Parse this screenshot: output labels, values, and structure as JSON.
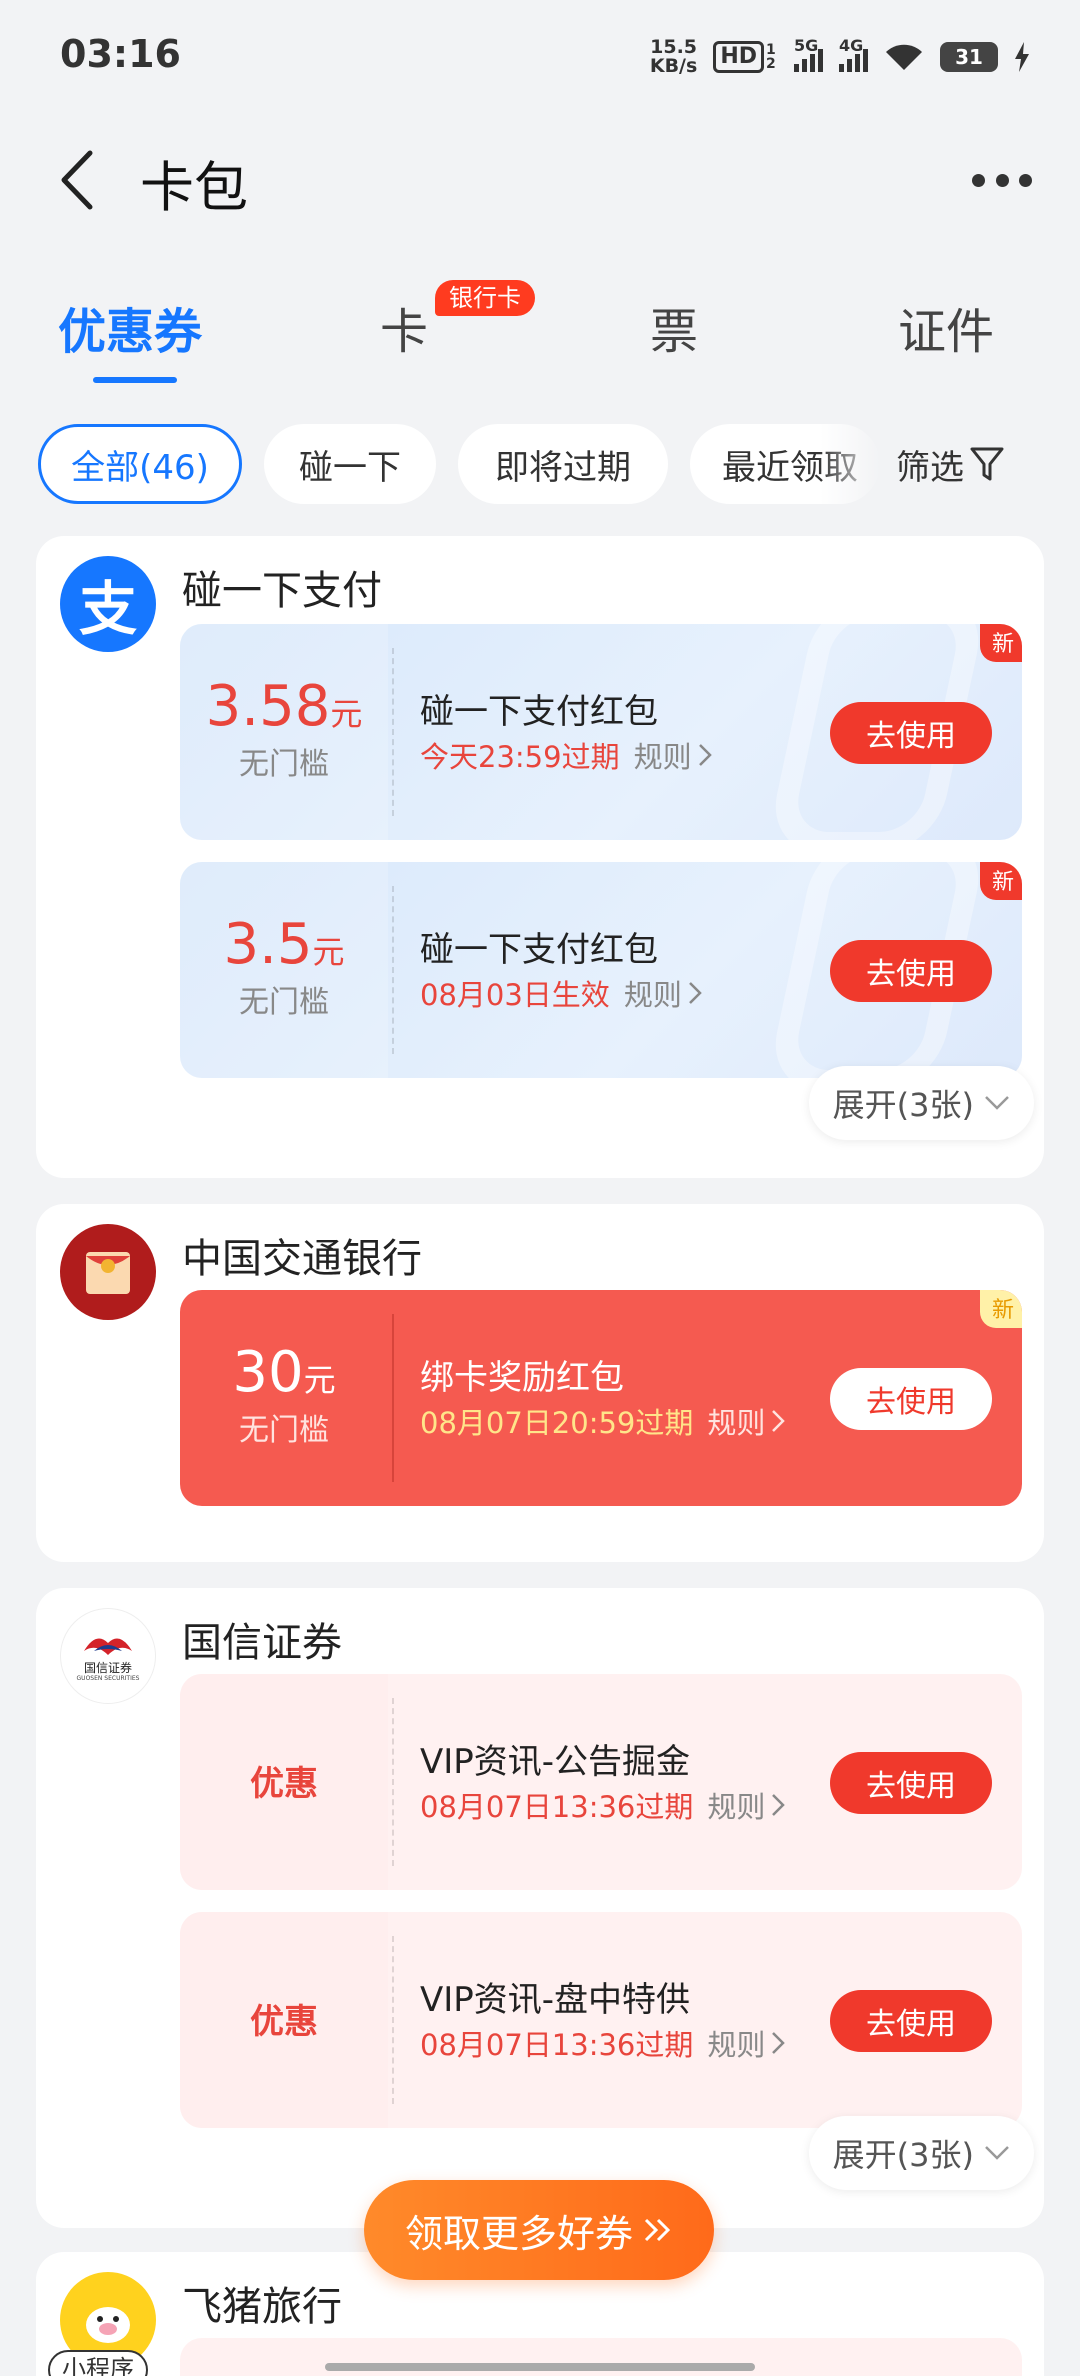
{
  "status": {
    "time": "03:16",
    "net_speed_value": "15.5",
    "net_speed_unit": "KB/s",
    "hd": "HD",
    "hd_sub": "1 2",
    "sig1_label": "5G",
    "sig2_label": "4G",
    "battery": "31"
  },
  "header": {
    "title": "卡包"
  },
  "tabs": {
    "items": [
      "优惠券",
      "卡",
      "票",
      "证件"
    ],
    "badge": "银行卡"
  },
  "chips": {
    "items": [
      "全部(46)",
      "碰一下",
      "即将过期",
      "最近领取"
    ],
    "filter": "筛选"
  },
  "sections": [
    {
      "name": "碰一下支付",
      "coupons": [
        {
          "amount": "3.58",
          "unit": "元",
          "cond": "无门槛",
          "title": "碰一下支付红包",
          "exp": "今天23:59过期",
          "rule": "规则",
          "btn": "去使用",
          "badge": "新"
        },
        {
          "amount": "3.5",
          "unit": "元",
          "cond": "无门槛",
          "title": "碰一下支付红包",
          "exp": "08月03日生效",
          "rule": "规则",
          "btn": "去使用",
          "badge": "新"
        }
      ],
      "expand": "展开(3张)"
    },
    {
      "name": "中国交通银行",
      "coupons": [
        {
          "amount": "30",
          "unit": "元",
          "cond": "无门槛",
          "title": "绑卡奖励红包",
          "exp": "08月07日20:59过期",
          "rule": "规则",
          "btn": "去使用",
          "badge": "新"
        }
      ]
    },
    {
      "name": "国信证券",
      "logo_text": "国信证券",
      "logo_sub": "GUOSEN SECURITIES",
      "coupons": [
        {
          "label": "优惠",
          "title": "VIP资讯-公告掘金",
          "exp": "08月07日13:36过期",
          "rule": "规则",
          "btn": "去使用"
        },
        {
          "label": "优惠",
          "title": "VIP资讯-盘中特供",
          "exp": "08月07日13:36过期",
          "rule": "规则",
          "btn": "去使用"
        }
      ],
      "expand": "展开(3张)"
    },
    {
      "name": "飞猪旅行",
      "mini_tag": "小程序"
    }
  ],
  "more_coupons_btn": "领取更多好券",
  "colors": {
    "accent": "#1677ff",
    "red": "#f0392c",
    "orange": "#ff7a22"
  },
  "alipay_glyph": "支"
}
